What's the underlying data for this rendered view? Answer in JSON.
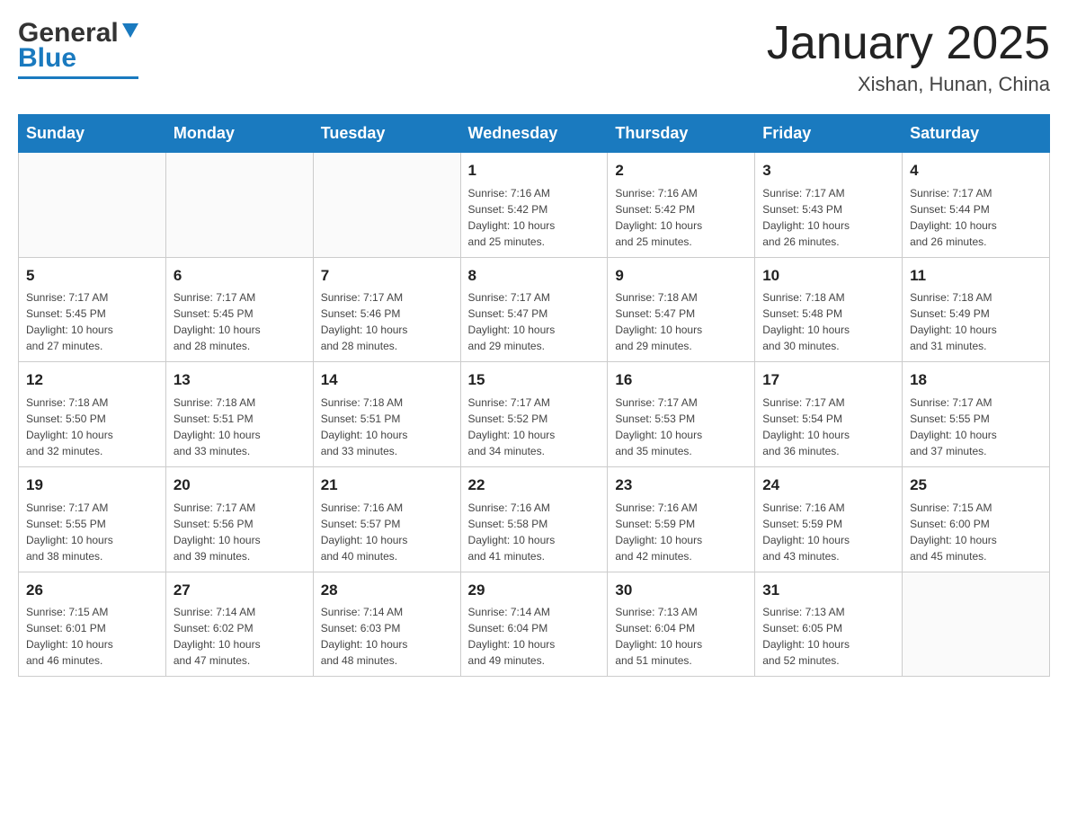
{
  "header": {
    "title": "January 2025",
    "subtitle": "Xishan, Hunan, China",
    "logo_general": "General",
    "logo_blue": "Blue"
  },
  "days_of_week": [
    "Sunday",
    "Monday",
    "Tuesday",
    "Wednesday",
    "Thursday",
    "Friday",
    "Saturday"
  ],
  "weeks": [
    {
      "days": [
        {
          "number": "",
          "info": ""
        },
        {
          "number": "",
          "info": ""
        },
        {
          "number": "",
          "info": ""
        },
        {
          "number": "1",
          "info": "Sunrise: 7:16 AM\nSunset: 5:42 PM\nDaylight: 10 hours\nand 25 minutes."
        },
        {
          "number": "2",
          "info": "Sunrise: 7:16 AM\nSunset: 5:42 PM\nDaylight: 10 hours\nand 25 minutes."
        },
        {
          "number": "3",
          "info": "Sunrise: 7:17 AM\nSunset: 5:43 PM\nDaylight: 10 hours\nand 26 minutes."
        },
        {
          "number": "4",
          "info": "Sunrise: 7:17 AM\nSunset: 5:44 PM\nDaylight: 10 hours\nand 26 minutes."
        }
      ]
    },
    {
      "days": [
        {
          "number": "5",
          "info": "Sunrise: 7:17 AM\nSunset: 5:45 PM\nDaylight: 10 hours\nand 27 minutes."
        },
        {
          "number": "6",
          "info": "Sunrise: 7:17 AM\nSunset: 5:45 PM\nDaylight: 10 hours\nand 28 minutes."
        },
        {
          "number": "7",
          "info": "Sunrise: 7:17 AM\nSunset: 5:46 PM\nDaylight: 10 hours\nand 28 minutes."
        },
        {
          "number": "8",
          "info": "Sunrise: 7:17 AM\nSunset: 5:47 PM\nDaylight: 10 hours\nand 29 minutes."
        },
        {
          "number": "9",
          "info": "Sunrise: 7:18 AM\nSunset: 5:47 PM\nDaylight: 10 hours\nand 29 minutes."
        },
        {
          "number": "10",
          "info": "Sunrise: 7:18 AM\nSunset: 5:48 PM\nDaylight: 10 hours\nand 30 minutes."
        },
        {
          "number": "11",
          "info": "Sunrise: 7:18 AM\nSunset: 5:49 PM\nDaylight: 10 hours\nand 31 minutes."
        }
      ]
    },
    {
      "days": [
        {
          "number": "12",
          "info": "Sunrise: 7:18 AM\nSunset: 5:50 PM\nDaylight: 10 hours\nand 32 minutes."
        },
        {
          "number": "13",
          "info": "Sunrise: 7:18 AM\nSunset: 5:51 PM\nDaylight: 10 hours\nand 33 minutes."
        },
        {
          "number": "14",
          "info": "Sunrise: 7:18 AM\nSunset: 5:51 PM\nDaylight: 10 hours\nand 33 minutes."
        },
        {
          "number": "15",
          "info": "Sunrise: 7:17 AM\nSunset: 5:52 PM\nDaylight: 10 hours\nand 34 minutes."
        },
        {
          "number": "16",
          "info": "Sunrise: 7:17 AM\nSunset: 5:53 PM\nDaylight: 10 hours\nand 35 minutes."
        },
        {
          "number": "17",
          "info": "Sunrise: 7:17 AM\nSunset: 5:54 PM\nDaylight: 10 hours\nand 36 minutes."
        },
        {
          "number": "18",
          "info": "Sunrise: 7:17 AM\nSunset: 5:55 PM\nDaylight: 10 hours\nand 37 minutes."
        }
      ]
    },
    {
      "days": [
        {
          "number": "19",
          "info": "Sunrise: 7:17 AM\nSunset: 5:55 PM\nDaylight: 10 hours\nand 38 minutes."
        },
        {
          "number": "20",
          "info": "Sunrise: 7:17 AM\nSunset: 5:56 PM\nDaylight: 10 hours\nand 39 minutes."
        },
        {
          "number": "21",
          "info": "Sunrise: 7:16 AM\nSunset: 5:57 PM\nDaylight: 10 hours\nand 40 minutes."
        },
        {
          "number": "22",
          "info": "Sunrise: 7:16 AM\nSunset: 5:58 PM\nDaylight: 10 hours\nand 41 minutes."
        },
        {
          "number": "23",
          "info": "Sunrise: 7:16 AM\nSunset: 5:59 PM\nDaylight: 10 hours\nand 42 minutes."
        },
        {
          "number": "24",
          "info": "Sunrise: 7:16 AM\nSunset: 5:59 PM\nDaylight: 10 hours\nand 43 minutes."
        },
        {
          "number": "25",
          "info": "Sunrise: 7:15 AM\nSunset: 6:00 PM\nDaylight: 10 hours\nand 45 minutes."
        }
      ]
    },
    {
      "days": [
        {
          "number": "26",
          "info": "Sunrise: 7:15 AM\nSunset: 6:01 PM\nDaylight: 10 hours\nand 46 minutes."
        },
        {
          "number": "27",
          "info": "Sunrise: 7:14 AM\nSunset: 6:02 PM\nDaylight: 10 hours\nand 47 minutes."
        },
        {
          "number": "28",
          "info": "Sunrise: 7:14 AM\nSunset: 6:03 PM\nDaylight: 10 hours\nand 48 minutes."
        },
        {
          "number": "29",
          "info": "Sunrise: 7:14 AM\nSunset: 6:04 PM\nDaylight: 10 hours\nand 49 minutes."
        },
        {
          "number": "30",
          "info": "Sunrise: 7:13 AM\nSunset: 6:04 PM\nDaylight: 10 hours\nand 51 minutes."
        },
        {
          "number": "31",
          "info": "Sunrise: 7:13 AM\nSunset: 6:05 PM\nDaylight: 10 hours\nand 52 minutes."
        },
        {
          "number": "",
          "info": ""
        }
      ]
    }
  ]
}
